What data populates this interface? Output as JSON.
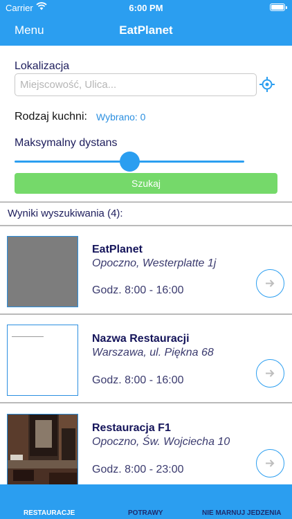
{
  "status": {
    "carrier": "Carrier",
    "time": "6:00 PM"
  },
  "nav": {
    "menu": "Menu",
    "title": "EatPlanet"
  },
  "search": {
    "location_label": "Lokalizacja",
    "location_placeholder": "Miejscowość, Ulica...",
    "location_value": "",
    "cuisine_label": "Rodzaj kuchni:",
    "cuisine_selected": "Wybrano: 0",
    "distance_label": "Maksymalny dystans",
    "distance_level": 0.5,
    "search_button": "Szukaj"
  },
  "results": {
    "header": "Wyniki wyszukiwania (4):",
    "items": [
      {
        "name": "EatPlanet",
        "address": "Opoczno, Westerplatte 1j",
        "hours": "Godz. 8:00 - 16:00",
        "thumb": "gray-placeholder"
      },
      {
        "name": "Nazwa Restauracji",
        "address": "Warszawa, ul. Piękna 68",
        "hours": "Godz. 8:00 - 16:00",
        "thumb": "blank-document"
      },
      {
        "name": "Restauracja F1",
        "address": "Opoczno, Św. Wojciecha 10",
        "hours": "Godz. 8:00 - 23:00",
        "thumb": "interior-photo"
      }
    ]
  },
  "tabs": [
    {
      "label": "RESTAURACJE",
      "active": true
    },
    {
      "label": "POTRAWY",
      "active": false
    },
    {
      "label": "NIE MARNUJ JEDZENIA",
      "active": false
    }
  ],
  "colors": {
    "primary": "#2b9ef0",
    "button_green": "#75d96a",
    "text_navy": "#14145a"
  }
}
